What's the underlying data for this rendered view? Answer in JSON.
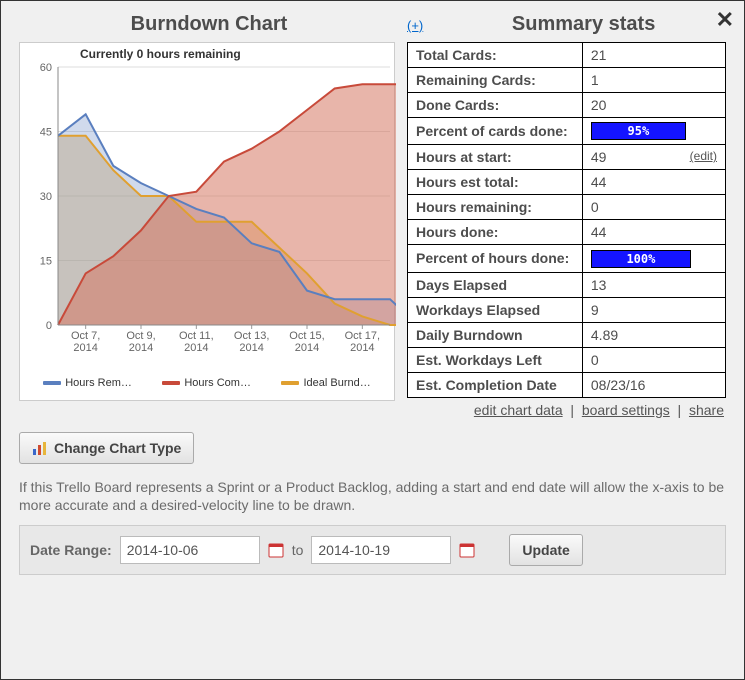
{
  "chart": {
    "title": "Burndown Chart",
    "subtitle": "Currently 0 hours remaining",
    "legend": {
      "remaining": "Hours Rem…",
      "completed": "Hours Com…",
      "ideal": "Ideal Burnd…"
    },
    "colors": {
      "remaining": "#5a7fbf",
      "remaining_fill": "rgba(120,150,200,0.35)",
      "completed": "#c84a3a",
      "completed_fill": "rgba(214,120,100,0.55)",
      "ideal": "#e0a030",
      "ideal_fill": "rgba(224,176,96,0.45)"
    },
    "x_labels": [
      "Oct 7, 2014",
      "Oct 9, 2014",
      "Oct 11, 2014",
      "Oct 13, 2014",
      "Oct 15, 2014",
      "Oct 17, 2014"
    ]
  },
  "chart_data": {
    "type": "line",
    "title": "Burndown Chart — Currently 0 hours remaining",
    "xlabel": "",
    "ylabel": "",
    "y_ticks": [
      0,
      15,
      30,
      45,
      60
    ],
    "ylim": [
      0,
      60
    ],
    "x": [
      "Oct 6",
      "Oct 7",
      "Oct 8",
      "Oct 9",
      "Oct 10",
      "Oct 11",
      "Oct 12",
      "Oct 13",
      "Oct 14",
      "Oct 15",
      "Oct 16",
      "Oct 17",
      "Oct 18"
    ],
    "series": [
      {
        "name": "Hours Remaining",
        "values": [
          44,
          49,
          37,
          33,
          30,
          27,
          25,
          19,
          17,
          8,
          6,
          6,
          6,
          0
        ]
      },
      {
        "name": "Hours Completed",
        "values": [
          0,
          12,
          16,
          22,
          30,
          31,
          38,
          41,
          45,
          50,
          55,
          56,
          56,
          56
        ]
      },
      {
        "name": "Ideal Burndown",
        "values": [
          44,
          44,
          36,
          30,
          30,
          24,
          24,
          24,
          18,
          12,
          5,
          2,
          0,
          0
        ]
      }
    ]
  },
  "summary": {
    "title": "Summary stats",
    "expand": "(+)",
    "rows": [
      {
        "label": "Total Cards:",
        "value": "21"
      },
      {
        "label": "Remaining Cards:",
        "value": "1"
      },
      {
        "label": "Done Cards:",
        "value": "20"
      },
      {
        "label": "Percent of cards done:",
        "value": "95%",
        "bar": 95
      },
      {
        "label": "Hours at start:",
        "value": "49",
        "edit": "(edit)"
      },
      {
        "label": "Hours est total:",
        "value": "44"
      },
      {
        "label": "Hours remaining:",
        "value": "0"
      },
      {
        "label": "Hours done:",
        "value": "44"
      },
      {
        "label": "Percent of hours done:",
        "value": "100%",
        "bar": 100
      },
      {
        "label": "Days Elapsed",
        "value": "13"
      },
      {
        "label": "Workdays Elapsed",
        "value": "9"
      },
      {
        "label": "Daily Burndown",
        "value": "4.89"
      },
      {
        "label": "Est. Workdays Left",
        "value": "0"
      },
      {
        "label": "Est. Completion Date",
        "value": "08/23/16"
      }
    ]
  },
  "links": {
    "edit_chart": "edit chart data",
    "board_settings": "board settings",
    "share": "share"
  },
  "change_btn": "Change Chart Type",
  "note": "If this Trello Board represents a Sprint or a Product Backlog, adding a start and end date will allow the x-axis to be more accurate and a desired-velocity line to be drawn.",
  "range": {
    "label": "Date Range:",
    "from": "2014-10-06",
    "to_word": "to",
    "to": "2014-10-19",
    "update": "Update"
  }
}
